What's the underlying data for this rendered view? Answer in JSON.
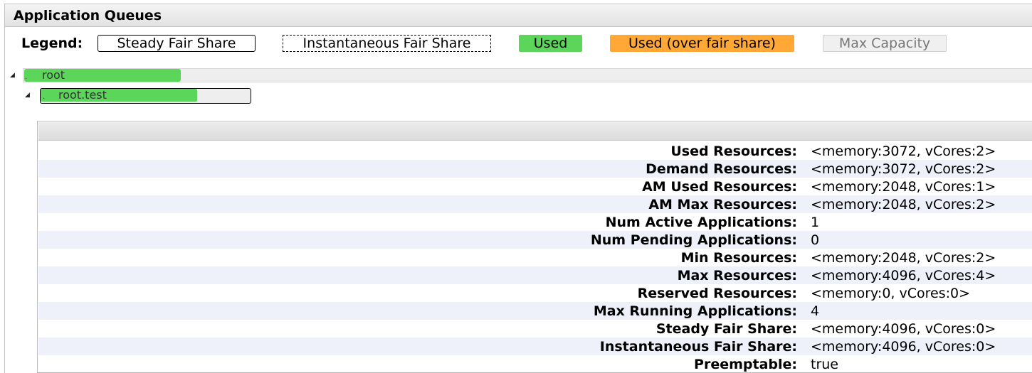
{
  "panel": {
    "title": "Application Queues"
  },
  "legend": {
    "label": "Legend:",
    "steady_fair_share": "Steady Fair Share",
    "instantaneous_fair_share": "Instantaneous Fair Share",
    "used": "Used",
    "used_over_fair_share": "Used (over fair share)",
    "max_capacity": "Max Capacity"
  },
  "colors": {
    "used": "#5bd65b",
    "over": "#ffa835",
    "max": "#f0f0f0"
  },
  "queues": {
    "root": {
      "name": "root",
      "toggle": "◢"
    },
    "test": {
      "name": "root.test",
      "toggle": "◢"
    }
  },
  "details": {
    "rows": [
      {
        "key": "Used Resources:",
        "value": "<memory:3072, vCores:2>"
      },
      {
        "key": "Demand Resources:",
        "value": "<memory:3072, vCores:2>"
      },
      {
        "key": "AM Used Resources:",
        "value": "<memory:2048, vCores:1>"
      },
      {
        "key": "AM Max Resources:",
        "value": "<memory:2048, vCores:2>"
      },
      {
        "key": "Num Active Applications:",
        "value": "1"
      },
      {
        "key": "Num Pending Applications:",
        "value": "0"
      },
      {
        "key": "Min Resources:",
        "value": "<memory:2048, vCores:2>"
      },
      {
        "key": "Max Resources:",
        "value": "<memory:4096, vCores:4>"
      },
      {
        "key": "Reserved Resources:",
        "value": "<memory:0, vCores:0>"
      },
      {
        "key": "Max Running Applications:",
        "value": "4"
      },
      {
        "key": "Steady Fair Share:",
        "value": "<memory:4096, vCores:0>"
      },
      {
        "key": "Instantaneous Fair Share:",
        "value": "<memory:4096, vCores:0>"
      },
      {
        "key": "Preemptable:",
        "value": "true"
      }
    ]
  }
}
